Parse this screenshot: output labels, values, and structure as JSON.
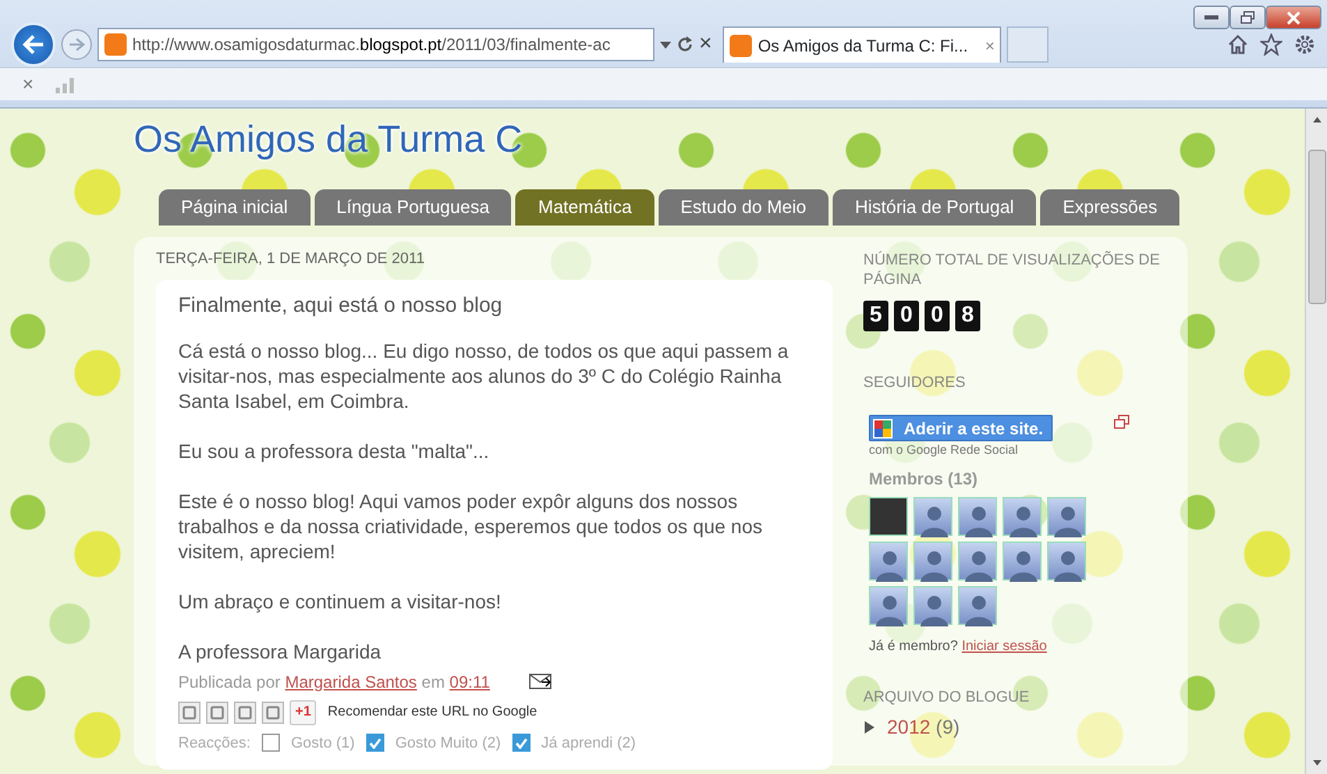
{
  "browser": {
    "address": "http://www.osamigosdaturmac.**blogspot.pt**/2011/03/finalmente-ac",
    "tabs": [
      {
        "label": "Os Amigos da Turma C: Fi...",
        "selected": true
      }
    ],
    "close_glyph": "×",
    "toolbar_close": "×"
  },
  "blog": {
    "title": "Os Amigos da Turma C",
    "tabs": [
      {
        "label": "Página inicial",
        "selected": false
      },
      {
        "label": "Língua Portuguesa",
        "selected": false
      },
      {
        "label": "Matemática",
        "selected": true
      },
      {
        "label": "Estudo do Meio",
        "selected": false
      },
      {
        "label": "História de Portugal",
        "selected": false
      },
      {
        "label": "Expressões",
        "selected": false
      }
    ]
  },
  "post": {
    "date": "TERÇA-FEIRA, 1 DE MARÇO DE 2011",
    "title": "Finalmente, aqui está o nosso blog",
    "paragraphs": [
      "Cá está o nosso blog... Eu digo nosso, de todos os que aqui passem a visitar-nos, mas especialmente aos alunos do 3º C do Colégio Rainha Santa Isabel, em Coimbra.",
      "Eu sou a professora desta \"malta\"...",
      "Este é o nosso blog! Aqui vamos poder expôr alguns dos nossos trabalhos e da nossa criatividade, esperemos que todos os que nos visitem, apreciem!",
      "Um abraço e continuem a visitar-nos!",
      "A professora Margarida"
    ],
    "byline": {
      "prefix": "Publicada por",
      "author": "Margarida Santos",
      "middle": "em",
      "time": "09:11"
    },
    "share": {
      "plus_one": "+1",
      "recommend": "Recomendar este URL no Google"
    },
    "reactions_label": "Reacções:",
    "reactions": [
      {
        "label": "Gosto (1)",
        "checked": false
      },
      {
        "label": "Gosto Muito (2)",
        "checked": true
      },
      {
        "label": "Já aprendi (2)",
        "checked": true
      }
    ]
  },
  "sidebar": {
    "views_title": "NÚMERO TOTAL DE VISUALIZAÇÕES DE PÁGINA",
    "views_digits": [
      "5",
      "0",
      "0",
      "8"
    ],
    "followers_title": "SEGUIDORES",
    "join_button": "Aderir a este site.",
    "join_sub": "com o Google Rede Social",
    "members_title": "Membros (13)",
    "members": [
      {
        "kind": "photo"
      },
      {
        "kind": "silhouette"
      },
      {
        "kind": "silhouette"
      },
      {
        "kind": "silhouette"
      },
      {
        "kind": "silhouette"
      },
      {
        "kind": "silhouette"
      },
      {
        "kind": "silhouette"
      },
      {
        "kind": "silhouette"
      },
      {
        "kind": "silhouette"
      },
      {
        "kind": "silhouette"
      },
      {
        "kind": "silhouette"
      },
      {
        "kind": "silhouette"
      },
      {
        "kind": "silhouette"
      }
    ],
    "member_question": "Já é membro?",
    "sign_in": "Iniciar sessão",
    "archive_title": "ARQUIVO DO BLOGUE",
    "archive": [
      {
        "label": "2012",
        "count": "(9)",
        "expanded": false
      }
    ]
  }
}
